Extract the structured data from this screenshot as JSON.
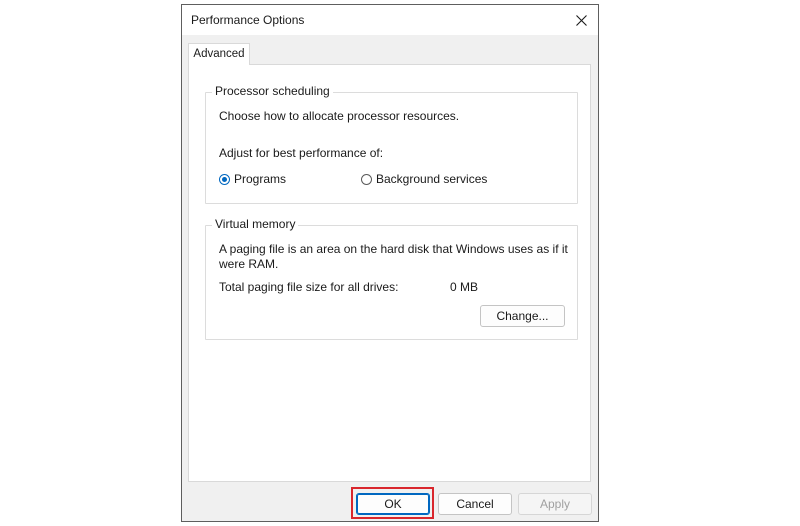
{
  "window": {
    "title": "Performance Options",
    "close_label": "×"
  },
  "tabs": [
    {
      "label": "Advanced"
    }
  ],
  "processor_scheduling": {
    "legend": "Processor scheduling",
    "description": "Choose how to allocate processor resources.",
    "adjust_label": "Adjust for best performance of:",
    "options": [
      {
        "label": "Programs",
        "selected": true
      },
      {
        "label": "Background services",
        "selected": false
      }
    ]
  },
  "virtual_memory": {
    "legend": "Virtual memory",
    "description_line1": "A paging file is an area on the hard disk that Windows uses as if it",
    "description_line2": "were RAM.",
    "total_label": "Total paging file size for all drives:",
    "total_value": "0 MB",
    "change_button": "Change..."
  },
  "buttons": {
    "ok": "OK",
    "cancel": "Cancel",
    "apply": "Apply"
  },
  "colors": {
    "accent": "#0067c0",
    "highlight": "#d9262c"
  },
  "icons": {
    "close": "close-icon"
  }
}
